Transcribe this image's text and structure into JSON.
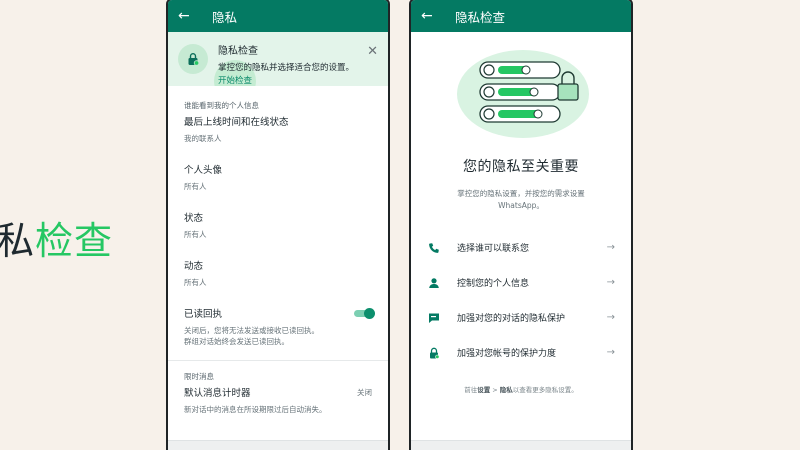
{
  "slogan": {
    "part1": "私",
    "part2": "检查"
  },
  "left_phone": {
    "appbar": {
      "back_icon": "←",
      "title": "隐私"
    },
    "banner": {
      "title": "隐私检查",
      "subtitle": "掌控您的隐私并选择适合您的设置。",
      "link": "开始检查",
      "close": "✕"
    },
    "section_personal": "谁能看到我的个人信息",
    "items": [
      {
        "title": "最后上线时间和在线状态",
        "value": "我的联系人"
      },
      {
        "title": "个人头像",
        "value": "所有人"
      },
      {
        "title": "状态",
        "value": "所有人"
      },
      {
        "title": "动态",
        "value": "所有人"
      }
    ],
    "read_receipts": {
      "title": "已读回执",
      "desc1": "关闭后，您将无法发送或接收已读回执。",
      "desc2": "群组对话始终会发送已读回执。",
      "enabled": true
    },
    "section_disappearing": "限时消息",
    "timer": {
      "title": "默认消息计时器",
      "value": "关闭",
      "desc": "新对话中的消息在所设期限过后自动消失。"
    }
  },
  "right_phone": {
    "appbar": {
      "back_icon": "←",
      "title": "隐私检查"
    },
    "heading": "您的隐私至关重要",
    "desc_line1": "掌控您的隐私设置，并按您的需求设置",
    "desc_line2": "WhatsApp。",
    "options": [
      {
        "icon": "phone-icon",
        "label": "选择谁可以联系您",
        "arrow": "→"
      },
      {
        "icon": "person-icon",
        "label": "控制您的个人信息",
        "arrow": "→"
      },
      {
        "icon": "chat-icon",
        "label": "加强对您的对话的隐私保护",
        "arrow": "→"
      },
      {
        "icon": "lock-icon",
        "label": "加强对您帐号的保护力度",
        "arrow": "→"
      }
    ],
    "footer": {
      "pre": "前往",
      "bold1": "设置",
      "sep": " > ",
      "bold2": "隐私",
      "post": "以查看更多隐私设置。"
    }
  },
  "colors": {
    "header": "#047a63",
    "accent": "#25c763",
    "background": "#f7f1ea",
    "banner": "#e3f4ea"
  }
}
